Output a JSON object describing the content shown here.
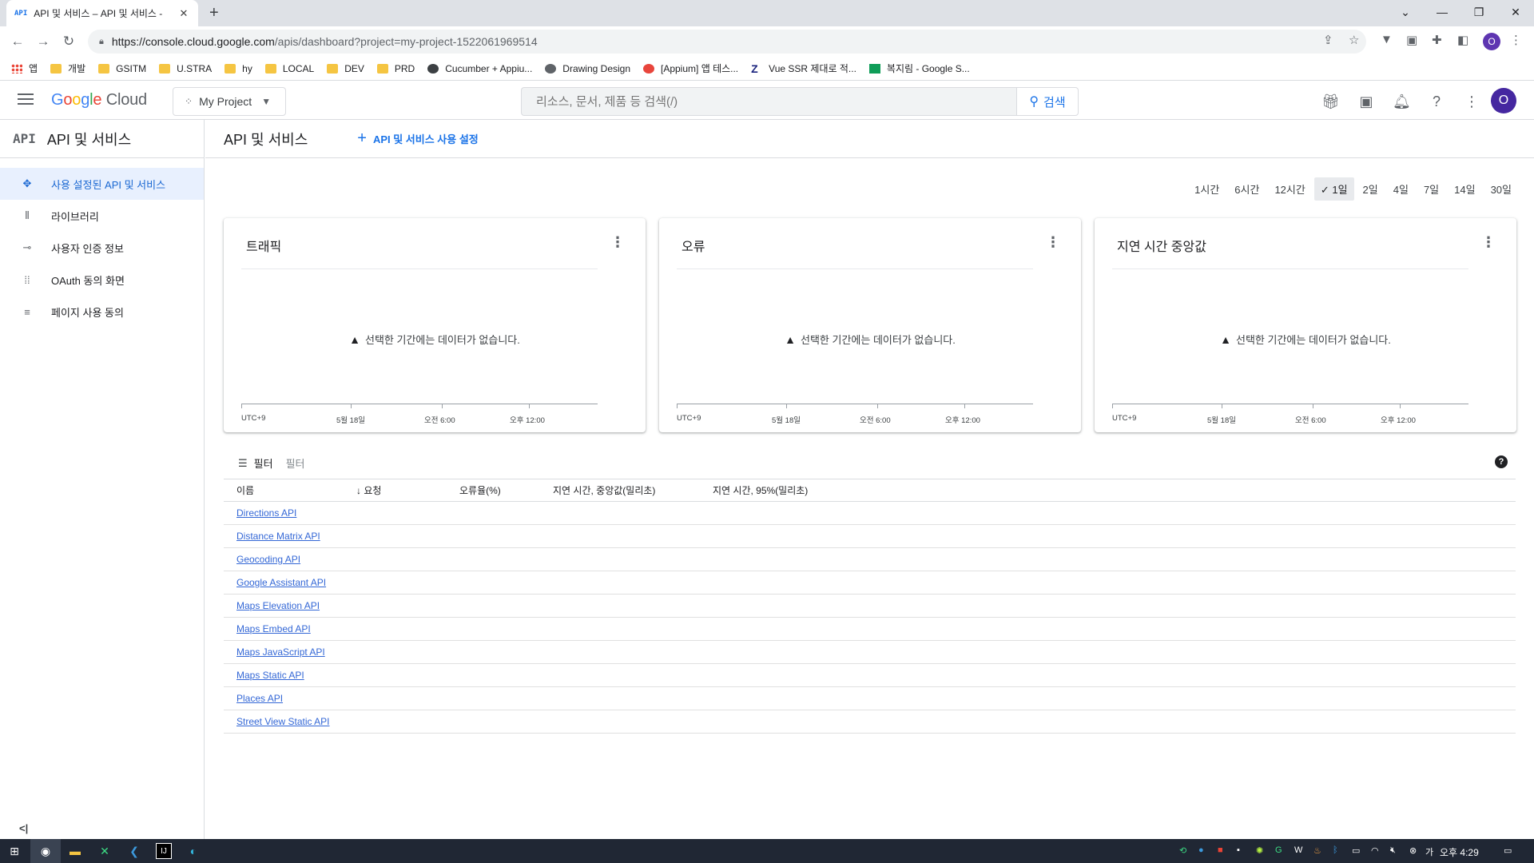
{
  "browser": {
    "tab_favicon": "API",
    "tab_title": "API 및 서비스 – API 및 서비스 -",
    "url_host": "https://console.cloud.google.com",
    "url_path": "/apis/dashboard?project=my-project-1522061969514",
    "profile_initial": "O",
    "bookmarks": [
      {
        "label": "앱",
        "icon": "apps-grid-icon"
      },
      {
        "label": "개발",
        "icon": "folder-icon"
      },
      {
        "label": "GSITM",
        "icon": "folder-icon"
      },
      {
        "label": "U.STRA",
        "icon": "folder-icon"
      },
      {
        "label": "hy",
        "icon": "folder-icon"
      },
      {
        "label": "LOCAL",
        "icon": "folder-icon"
      },
      {
        "label": "DEV",
        "icon": "folder-icon"
      },
      {
        "label": "PRD",
        "icon": "folder-icon"
      },
      {
        "label": "Cucumber + Appiu...",
        "icon": "cucumber-icon"
      },
      {
        "label": "Drawing Design",
        "icon": "globe-icon"
      },
      {
        "label": "[Appium] 앱 테스...",
        "icon": "site-icon"
      },
      {
        "label": "Vue SSR 제대로 적...",
        "icon": "z-icon"
      },
      {
        "label": "복지림 - Google S...",
        "icon": "sheets-icon"
      }
    ]
  },
  "header": {
    "logo_google": "Google",
    "logo_cloud": "Cloud",
    "project": "My Project",
    "search_placeholder": "리소스, 문서, 제품 등 검색(/)",
    "search_button": "검색",
    "avatar_initial": "O"
  },
  "sidebar": {
    "title_icon": "API",
    "title": "API 및 서비스",
    "items": [
      {
        "label": "사용 설정된 API 및 서비스",
        "icon": "api-hub-icon",
        "active": true
      },
      {
        "label": "라이브러리",
        "icon": "library-icon",
        "active": false
      },
      {
        "label": "사용자 인증 정보",
        "icon": "key-icon",
        "active": false
      },
      {
        "label": "OAuth 동의 화면",
        "icon": "consent-icon",
        "active": false
      },
      {
        "label": "페이지 사용 동의",
        "icon": "settings-list-icon",
        "active": false
      }
    ],
    "collapse_label": "<|"
  },
  "main": {
    "title": "API 및 서비스",
    "enable_button": "API 및 서비스 사용 설정",
    "ranges": [
      "1시간",
      "6시간",
      "12시간",
      "1일",
      "2일",
      "4일",
      "7일",
      "14일",
      "30일"
    ],
    "selected_range": "1일",
    "cards": [
      {
        "title": "트래픽",
        "message": "선택한 기간에는 데이터가 없습니다.",
        "ticks": [
          "UTC+9",
          "5월 18일",
          "오전 6:00",
          "오후 12:00"
        ]
      },
      {
        "title": "오류",
        "message": "선택한 기간에는 데이터가 없습니다.",
        "ticks": [
          "UTC+9",
          "5월 18일",
          "오전 6:00",
          "오후 12:00"
        ]
      },
      {
        "title": "지연 시간 중앙값",
        "message": "선택한 기간에는 데이터가 없습니다.",
        "ticks": [
          "UTC+9",
          "5월 18일",
          "오전 6:00",
          "오후 12:00"
        ]
      }
    ],
    "filter_label": "필터",
    "filter_placeholder": "필터",
    "columns": [
      "이름",
      "요청",
      "오류율(%)",
      "지연 시간, 중앙값(밀리초)",
      "지연 시간, 95%(밀리초)"
    ],
    "apis": [
      "Directions API",
      "Distance Matrix API",
      "Geocoding API",
      "Google Assistant API",
      "Maps Elevation API",
      "Maps Embed API",
      "Maps JavaScript API",
      "Maps Static API",
      "Places API",
      "Street View Static API"
    ]
  },
  "taskbar": {
    "clock": "오후 4:29"
  }
}
